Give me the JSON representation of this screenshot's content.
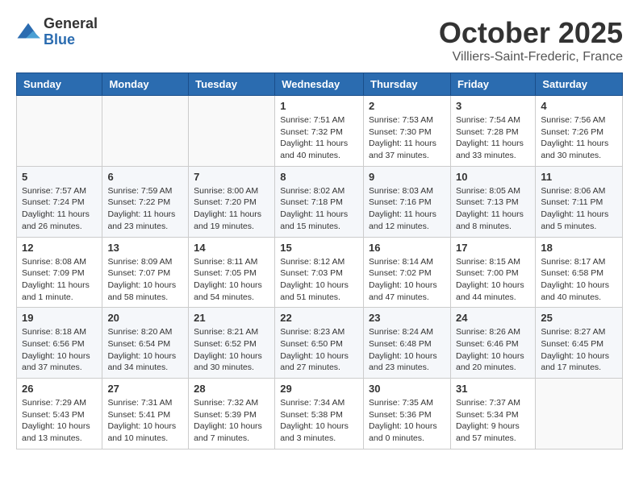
{
  "header": {
    "logo_general": "General",
    "logo_blue": "Blue",
    "month_title": "October 2025",
    "location": "Villiers-Saint-Frederic, France"
  },
  "weekdays": [
    "Sunday",
    "Monday",
    "Tuesday",
    "Wednesday",
    "Thursday",
    "Friday",
    "Saturday"
  ],
  "weeks": [
    [
      {
        "day": "",
        "sunrise": "",
        "sunset": "",
        "daylight": ""
      },
      {
        "day": "",
        "sunrise": "",
        "sunset": "",
        "daylight": ""
      },
      {
        "day": "",
        "sunrise": "",
        "sunset": "",
        "daylight": ""
      },
      {
        "day": "1",
        "sunrise": "Sunrise: 7:51 AM",
        "sunset": "Sunset: 7:32 PM",
        "daylight": "Daylight: 11 hours and 40 minutes."
      },
      {
        "day": "2",
        "sunrise": "Sunrise: 7:53 AM",
        "sunset": "Sunset: 7:30 PM",
        "daylight": "Daylight: 11 hours and 37 minutes."
      },
      {
        "day": "3",
        "sunrise": "Sunrise: 7:54 AM",
        "sunset": "Sunset: 7:28 PM",
        "daylight": "Daylight: 11 hours and 33 minutes."
      },
      {
        "day": "4",
        "sunrise": "Sunrise: 7:56 AM",
        "sunset": "Sunset: 7:26 PM",
        "daylight": "Daylight: 11 hours and 30 minutes."
      }
    ],
    [
      {
        "day": "5",
        "sunrise": "Sunrise: 7:57 AM",
        "sunset": "Sunset: 7:24 PM",
        "daylight": "Daylight: 11 hours and 26 minutes."
      },
      {
        "day": "6",
        "sunrise": "Sunrise: 7:59 AM",
        "sunset": "Sunset: 7:22 PM",
        "daylight": "Daylight: 11 hours and 23 minutes."
      },
      {
        "day": "7",
        "sunrise": "Sunrise: 8:00 AM",
        "sunset": "Sunset: 7:20 PM",
        "daylight": "Daylight: 11 hours and 19 minutes."
      },
      {
        "day": "8",
        "sunrise": "Sunrise: 8:02 AM",
        "sunset": "Sunset: 7:18 PM",
        "daylight": "Daylight: 11 hours and 15 minutes."
      },
      {
        "day": "9",
        "sunrise": "Sunrise: 8:03 AM",
        "sunset": "Sunset: 7:16 PM",
        "daylight": "Daylight: 11 hours and 12 minutes."
      },
      {
        "day": "10",
        "sunrise": "Sunrise: 8:05 AM",
        "sunset": "Sunset: 7:13 PM",
        "daylight": "Daylight: 11 hours and 8 minutes."
      },
      {
        "day": "11",
        "sunrise": "Sunrise: 8:06 AM",
        "sunset": "Sunset: 7:11 PM",
        "daylight": "Daylight: 11 hours and 5 minutes."
      }
    ],
    [
      {
        "day": "12",
        "sunrise": "Sunrise: 8:08 AM",
        "sunset": "Sunset: 7:09 PM",
        "daylight": "Daylight: 11 hours and 1 minute."
      },
      {
        "day": "13",
        "sunrise": "Sunrise: 8:09 AM",
        "sunset": "Sunset: 7:07 PM",
        "daylight": "Daylight: 10 hours and 58 minutes."
      },
      {
        "day": "14",
        "sunrise": "Sunrise: 8:11 AM",
        "sunset": "Sunset: 7:05 PM",
        "daylight": "Daylight: 10 hours and 54 minutes."
      },
      {
        "day": "15",
        "sunrise": "Sunrise: 8:12 AM",
        "sunset": "Sunset: 7:03 PM",
        "daylight": "Daylight: 10 hours and 51 minutes."
      },
      {
        "day": "16",
        "sunrise": "Sunrise: 8:14 AM",
        "sunset": "Sunset: 7:02 PM",
        "daylight": "Daylight: 10 hours and 47 minutes."
      },
      {
        "day": "17",
        "sunrise": "Sunrise: 8:15 AM",
        "sunset": "Sunset: 7:00 PM",
        "daylight": "Daylight: 10 hours and 44 minutes."
      },
      {
        "day": "18",
        "sunrise": "Sunrise: 8:17 AM",
        "sunset": "Sunset: 6:58 PM",
        "daylight": "Daylight: 10 hours and 40 minutes."
      }
    ],
    [
      {
        "day": "19",
        "sunrise": "Sunrise: 8:18 AM",
        "sunset": "Sunset: 6:56 PM",
        "daylight": "Daylight: 10 hours and 37 minutes."
      },
      {
        "day": "20",
        "sunrise": "Sunrise: 8:20 AM",
        "sunset": "Sunset: 6:54 PM",
        "daylight": "Daylight: 10 hours and 34 minutes."
      },
      {
        "day": "21",
        "sunrise": "Sunrise: 8:21 AM",
        "sunset": "Sunset: 6:52 PM",
        "daylight": "Daylight: 10 hours and 30 minutes."
      },
      {
        "day": "22",
        "sunrise": "Sunrise: 8:23 AM",
        "sunset": "Sunset: 6:50 PM",
        "daylight": "Daylight: 10 hours and 27 minutes."
      },
      {
        "day": "23",
        "sunrise": "Sunrise: 8:24 AM",
        "sunset": "Sunset: 6:48 PM",
        "daylight": "Daylight: 10 hours and 23 minutes."
      },
      {
        "day": "24",
        "sunrise": "Sunrise: 8:26 AM",
        "sunset": "Sunset: 6:46 PM",
        "daylight": "Daylight: 10 hours and 20 minutes."
      },
      {
        "day": "25",
        "sunrise": "Sunrise: 8:27 AM",
        "sunset": "Sunset: 6:45 PM",
        "daylight": "Daylight: 10 hours and 17 minutes."
      }
    ],
    [
      {
        "day": "26",
        "sunrise": "Sunrise: 7:29 AM",
        "sunset": "Sunset: 5:43 PM",
        "daylight": "Daylight: 10 hours and 13 minutes."
      },
      {
        "day": "27",
        "sunrise": "Sunrise: 7:31 AM",
        "sunset": "Sunset: 5:41 PM",
        "daylight": "Daylight: 10 hours and 10 minutes."
      },
      {
        "day": "28",
        "sunrise": "Sunrise: 7:32 AM",
        "sunset": "Sunset: 5:39 PM",
        "daylight": "Daylight: 10 hours and 7 minutes."
      },
      {
        "day": "29",
        "sunrise": "Sunrise: 7:34 AM",
        "sunset": "Sunset: 5:38 PM",
        "daylight": "Daylight: 10 hours and 3 minutes."
      },
      {
        "day": "30",
        "sunrise": "Sunrise: 7:35 AM",
        "sunset": "Sunset: 5:36 PM",
        "daylight": "Daylight: 10 hours and 0 minutes."
      },
      {
        "day": "31",
        "sunrise": "Sunrise: 7:37 AM",
        "sunset": "Sunset: 5:34 PM",
        "daylight": "Daylight: 9 hours and 57 minutes."
      },
      {
        "day": "",
        "sunrise": "",
        "sunset": "",
        "daylight": ""
      }
    ]
  ]
}
